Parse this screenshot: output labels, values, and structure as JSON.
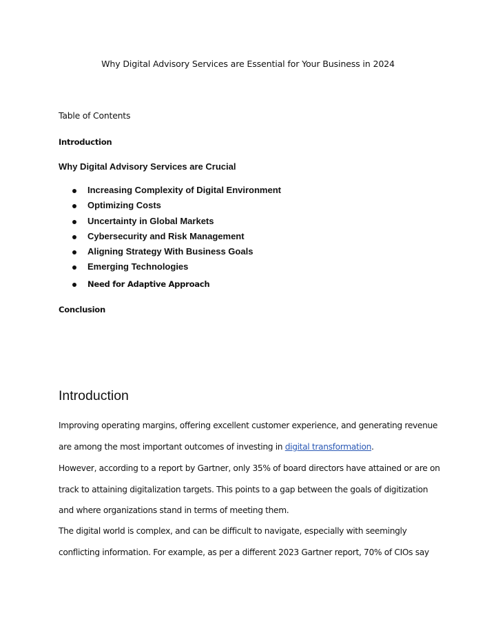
{
  "document": {
    "title": "Why Digital Advisory Services are Essential for Your Business in 2024",
    "toc": {
      "heading": "Table of Contents",
      "introduction": "Introduction",
      "why_section": "Why Digital Advisory Services are Crucial",
      "sub_items": [
        "Increasing Complexity of Digital Environment",
        "Optimizing Costs",
        "Uncertainty in Global Markets",
        "Cybersecurity and Risk Management",
        "Aligning Strategy With Business Goals",
        "Emerging Technologies",
        "Need for Adaptive Approach"
      ],
      "conclusion": "Conclusion"
    },
    "introduction": {
      "heading": "Introduction",
      "paragraph1": {
        "line1": "Improving operating margins, offering excellent customer experience, and generating revenue",
        "line2_before_link": "are among the most important outcomes of investing in ",
        "link_text": "digital transformation",
        "line2_after_link": "."
      },
      "paragraph2": {
        "line1": "However, according to a report by Gartner, only 35% of board directors have attained or are on",
        "line2": "track to attaining digitalization targets. This points to a gap between the goals of digitization",
        "line3": "and where organizations stand in terms of meeting them."
      },
      "paragraph3": {
        "line1": "The digital world is complex, and can be difficult to navigate, especially with seemingly",
        "line2": "conflicting information. For example, as per a different 2023 Gartner report, 70% of CIOs say"
      }
    },
    "colors": {
      "link": "#2b59b5",
      "text": "#111111",
      "background": "#ffffff"
    }
  }
}
